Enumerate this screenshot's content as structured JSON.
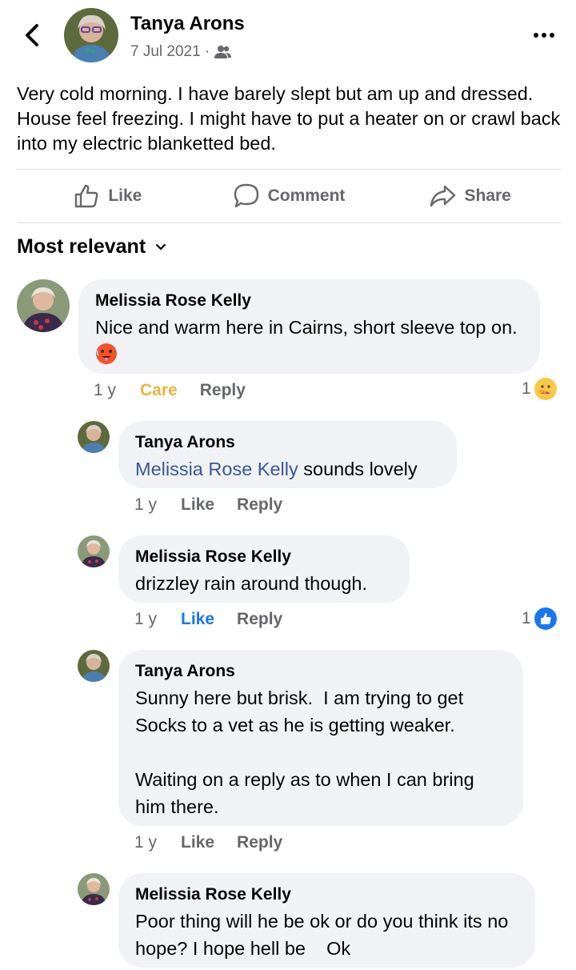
{
  "post": {
    "author": "Tanya Arons",
    "date": "7 Jul 2021 ·",
    "audience_icon": "friends-icon",
    "text": "Very  cold morning.  I have barely slept but am up and dressed.  House feel freezing.  I might have to put a heater on or crawl back into my electric blanketted bed."
  },
  "actions": {
    "like": "Like",
    "comment": "Comment",
    "share": "Share"
  },
  "sort_label": "Most relevant",
  "colors": {
    "care": "#e8b53e",
    "like_blue": "#1877f2",
    "mention": "#385898",
    "muted": "#65676b",
    "bubble": "#f0f2f5"
  },
  "comments": [
    {
      "name": "Melissia Rose Kelly",
      "text": "Nice and warm here in Cairns, short sleeve top on.",
      "emoji": "hot-face-emoji",
      "time": "1 y",
      "like_label": "Care",
      "reply_label": "Reply",
      "reaction_count": "1",
      "reaction_icon": "care-reaction-icon"
    },
    {
      "name": "Tanya Arons",
      "mention": "Melissia Rose Kelly",
      "text": " sounds lovely",
      "time": "1 y",
      "like_label": "Like",
      "reply_label": "Reply"
    },
    {
      "name": "Melissia Rose Kelly",
      "text": "drizzley rain around though.",
      "time": "1 y",
      "like_label": "Like",
      "reply_label": "Reply",
      "reaction_count": "1",
      "reaction_icon": "like-reaction-icon"
    },
    {
      "name": "Tanya Arons",
      "text": "Sunny here but brisk.  I am trying to get Socks to a vet as he is getting weaker.\n\nWaiting on a reply as to when I can bring him there.",
      "time": "1 y",
      "like_label": "Like",
      "reply_label": "Reply"
    },
    {
      "name": "Melissia Rose Kelly",
      "text": "Poor thing will he be ok or do you think its no hope? I hope hell be    Ok"
    }
  ]
}
